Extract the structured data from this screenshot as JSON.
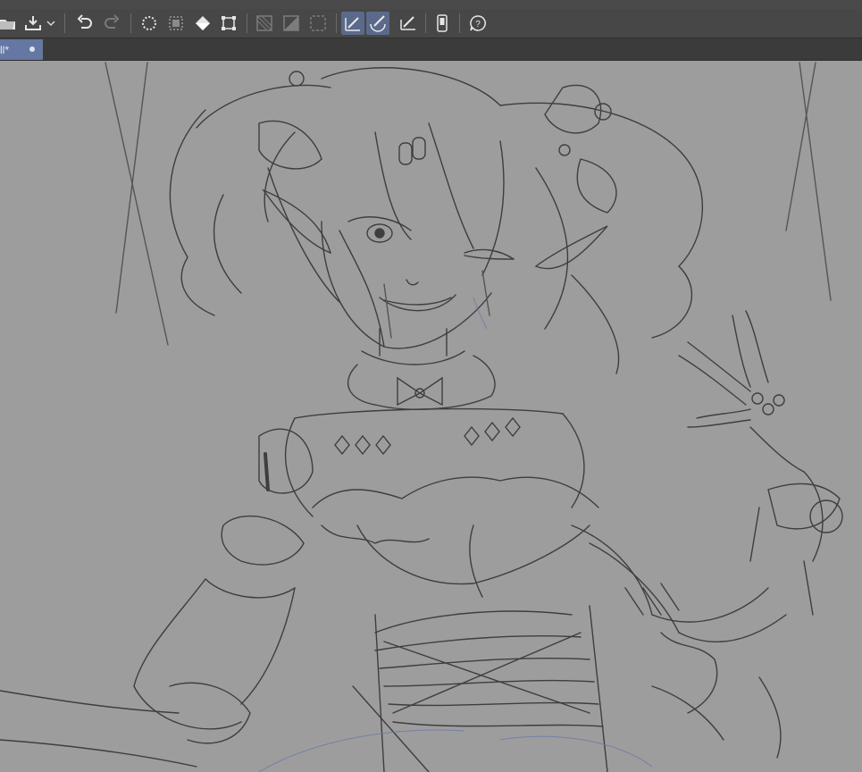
{
  "toolbar": {
    "buttons": [
      {
        "name": "open-folder-icon",
        "active": false
      },
      {
        "name": "save-icon",
        "active": false
      },
      {
        "name": "chevron-down-icon",
        "active": false
      },
      {
        "name": "undo-icon",
        "active": false
      },
      {
        "name": "redo-icon",
        "active": false
      },
      {
        "name": "clear-selection-icon",
        "active": false
      },
      {
        "name": "crop-icon",
        "active": false
      },
      {
        "name": "fill-icon",
        "active": false
      },
      {
        "name": "transform-icon",
        "active": false
      },
      {
        "name": "snap-ruler-icon",
        "active": false
      },
      {
        "name": "snap-special-ruler-icon",
        "active": false
      },
      {
        "name": "snap-grid-icon",
        "active": false
      },
      {
        "name": "pen-stabilize-icon",
        "active": true
      },
      {
        "name": "pen-vector-icon",
        "active": true
      },
      {
        "name": "pen-angle-icon",
        "active": false
      },
      {
        "name": "smartphone-icon",
        "active": false
      },
      {
        "name": "help-icon",
        "active": false
      }
    ]
  },
  "document": {
    "tab_label": "ll*",
    "modified_indicator": "●"
  }
}
